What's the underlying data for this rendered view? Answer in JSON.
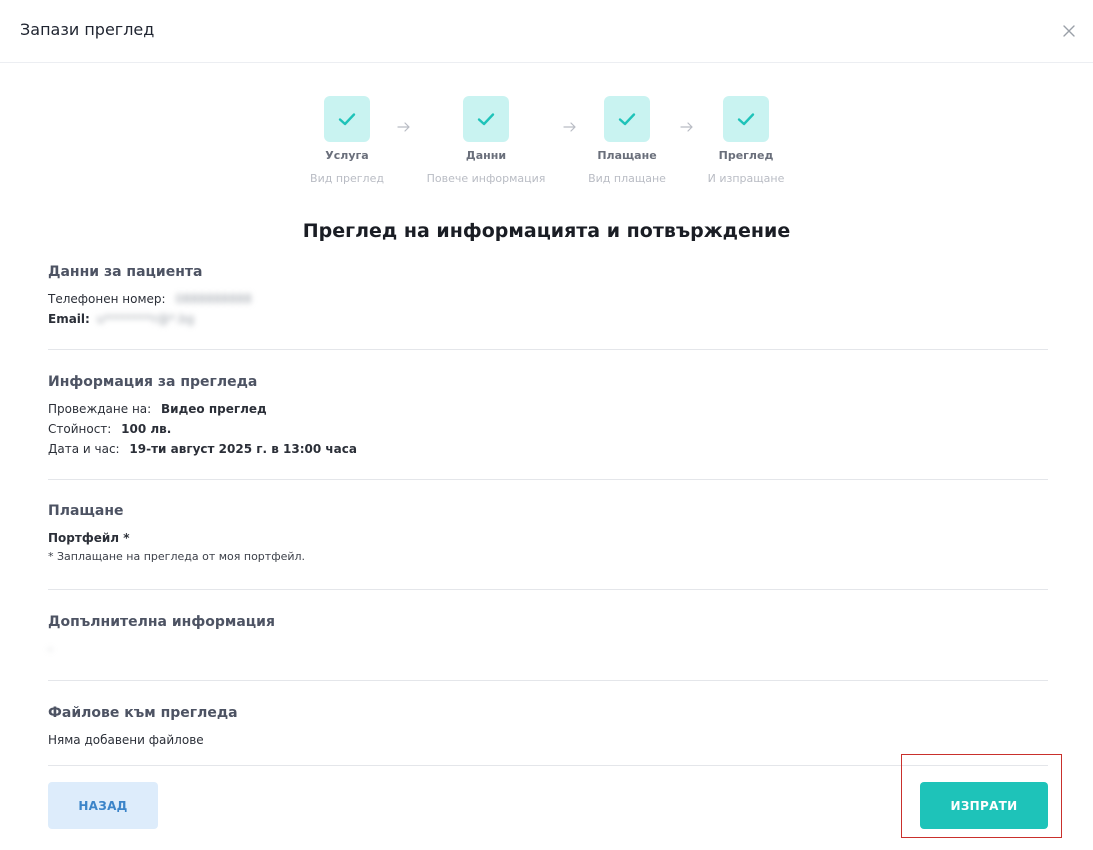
{
  "dialog": {
    "title": "Запази преглед",
    "close_icon": "close-icon"
  },
  "steps": [
    {
      "name": "Услуга",
      "desc": "Вид преглед",
      "status": "done"
    },
    {
      "name": "Данни",
      "desc": "Повече информация",
      "status": "done"
    },
    {
      "name": "Плащане",
      "desc": "Вид плащане",
      "status": "done"
    },
    {
      "name": "Преглед",
      "desc": "И изпращане",
      "status": "done"
    }
  ],
  "heading": "Преглед на информацията и потвърждение",
  "patient": {
    "title": "Данни за пациента",
    "phone_label": "Телефонен номер:",
    "phone_value": "0888888888",
    "email_label": "Email:",
    "email_value": "u********r@*.bg"
  },
  "exam": {
    "title": "Информация за прегледа",
    "mode_label": "Провеждане на:",
    "mode_value": "Видео преглед",
    "price_label": "Стойност:",
    "price_value": "100 лв.",
    "datetime_label": "Дата и час:",
    "datetime_value": "19-ти август 2025 г. в 13:00 часа"
  },
  "payment": {
    "title": "Плащане",
    "method": "Портфейл *",
    "note": "* Заплащане на прегледа от моя портфейл."
  },
  "additional": {
    "title": "Допълнителна информация",
    "value": "-"
  },
  "files": {
    "title": "Файлове към прегледа",
    "value": "Няма добавени файлове"
  },
  "buttons": {
    "back": "НАЗАД",
    "send": "ИЗПРАТИ"
  },
  "colors": {
    "accent": "#1ec3b9",
    "step_bg": "#c9f3f1",
    "back_bg": "#ddecfb",
    "back_text": "#3b84c9",
    "highlight": "#c9302c"
  }
}
